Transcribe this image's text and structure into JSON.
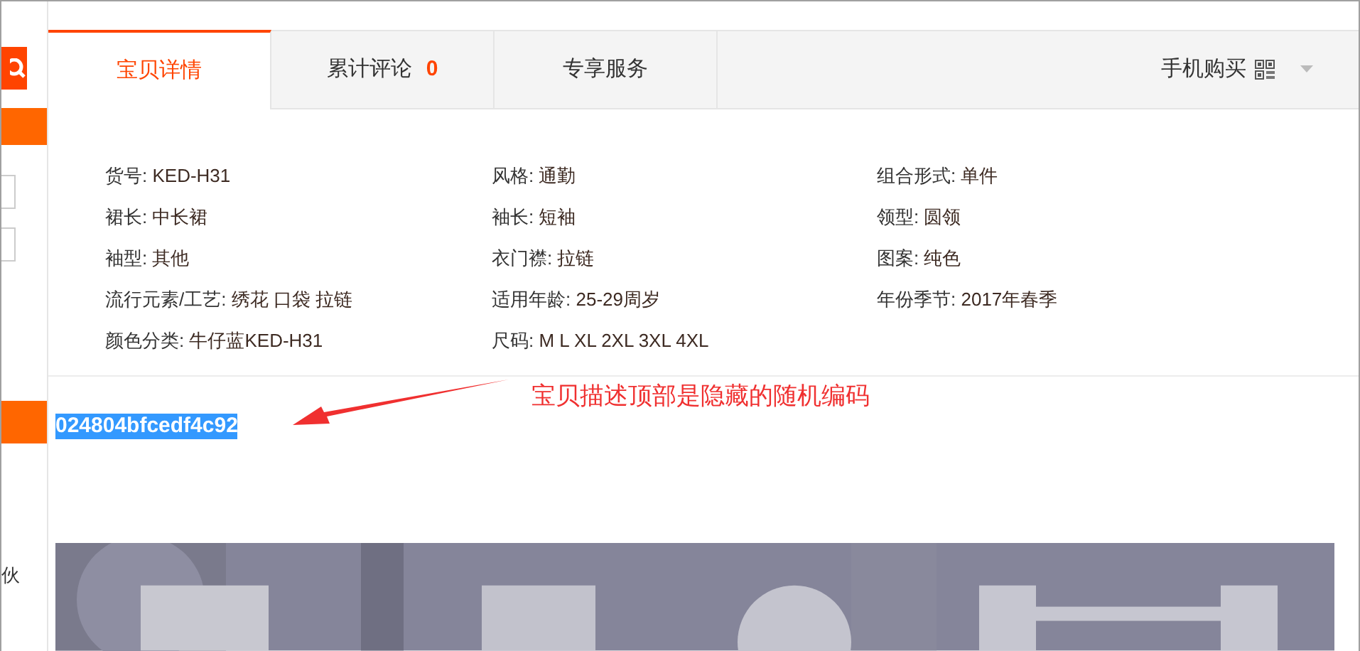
{
  "sidebar": {
    "text": "伙"
  },
  "tabs": [
    {
      "label": "宝贝详情",
      "selected": true
    },
    {
      "label": "累计评论",
      "count": "0",
      "selected": false
    },
    {
      "label": "专享服务",
      "selected": false
    }
  ],
  "mobile_buy": {
    "label": "手机购买"
  },
  "attributes": [
    {
      "label": "货号:",
      "value": "KED-H31"
    },
    {
      "label": "风格:",
      "value": "通勤"
    },
    {
      "label": "组合形式:",
      "value": "单件"
    },
    {
      "label": "裙长:",
      "value": "中长裙"
    },
    {
      "label": "袖长:",
      "value": "短袖"
    },
    {
      "label": "领型:",
      "value": "圆领"
    },
    {
      "label": "袖型:",
      "value": "其他"
    },
    {
      "label": "衣门襟:",
      "value": "拉链"
    },
    {
      "label": "图案:",
      "value": "纯色"
    },
    {
      "label": "流行元素/工艺:",
      "value": "绣花 口袋 拉链"
    },
    {
      "label": "适用年龄:",
      "value": "25-29周岁"
    },
    {
      "label": "年份季节:",
      "value": "2017年春季"
    },
    {
      "label": "颜色分类:",
      "value": "牛仔蓝KED-H31"
    },
    {
      "label": "尺码:",
      "value": "M L XL 2XL 3XL 4XL"
    }
  ],
  "product_code": {
    "text": "024804bfcedf4c92",
    "selected": true
  },
  "annotation": {
    "text": "宝贝描述顶部是隐藏的随机编码"
  }
}
